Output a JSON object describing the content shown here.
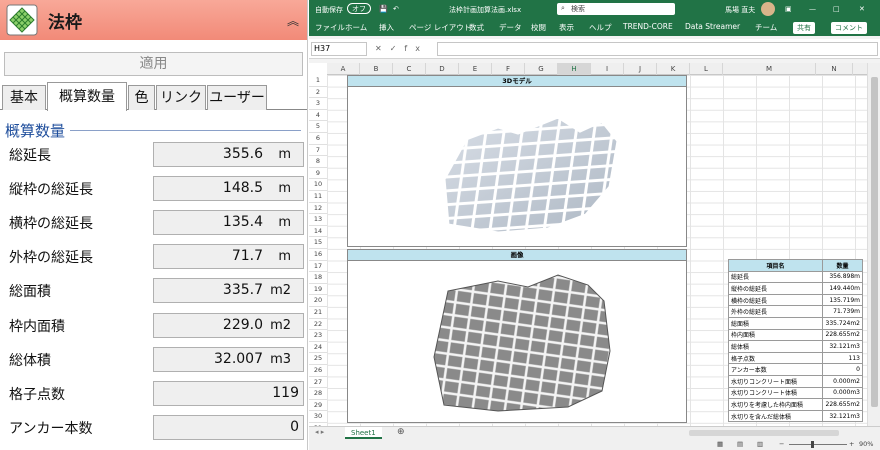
{
  "panel": {
    "title": "法枠",
    "apply_label": "適用",
    "tabs": [
      "基本",
      "概算数量",
      "色",
      "リンク",
      "ユーザー"
    ],
    "section": "概算数量",
    "rows": [
      {
        "label": "総延長",
        "value": "355.6",
        "unit": "m"
      },
      {
        "label": "縦枠の総延長",
        "value": "148.5",
        "unit": "m"
      },
      {
        "label": "横枠の総延長",
        "value": "135.4",
        "unit": "m"
      },
      {
        "label": "外枠の総延長",
        "value": "71.7",
        "unit": "m"
      },
      {
        "label": "総面積",
        "value": "335.7",
        "unit": "m2"
      },
      {
        "label": "枠内面積",
        "value": "229.0",
        "unit": "m2"
      },
      {
        "label": "総体積",
        "value": "32.007",
        "unit": "m3"
      },
      {
        "label": "格子点数",
        "value": "119",
        "unit": ""
      },
      {
        "label": "アンカー本数",
        "value": "0",
        "unit": ""
      }
    ]
  },
  "excel": {
    "autosave": "自動保存",
    "autosave_state": "オフ",
    "filename": "法枠計画加算法画.xlsx",
    "search": "検索",
    "user": "馬場 直夫",
    "menu": [
      "ファイル",
      "ホーム",
      "挿入",
      "ページ レイアウト",
      "数式",
      "データ",
      "校閲",
      "表示",
      "ヘルプ",
      "TREND-CORE",
      "Data Streamer",
      "チーム"
    ],
    "share": "共有",
    "comment": "コメント",
    "namebox": "H37",
    "fx": "fx",
    "columns": [
      "A",
      "B",
      "C",
      "D",
      "E",
      "F",
      "G",
      "H",
      "I",
      "J",
      "K",
      "L",
      "M",
      "N"
    ],
    "rows": [
      "1",
      "2",
      "3",
      "4",
      "5",
      "6",
      "7",
      "8",
      "9",
      "10",
      "11",
      "12",
      "13",
      "14",
      "15",
      "16",
      "17",
      "18",
      "19",
      "20",
      "21",
      "22",
      "23",
      "24",
      "25",
      "26",
      "27",
      "28",
      "29",
      "30",
      "31"
    ],
    "frame1_title": "3Dモデル",
    "frame2_title": "画像",
    "table_headers": [
      "項目名",
      "数量"
    ],
    "table_rows": [
      [
        "総延長",
        "356.898m"
      ],
      [
        "縦枠の総延長",
        "149.440m"
      ],
      [
        "横枠の総延長",
        "135.719m"
      ],
      [
        "外枠の総延長",
        "71.739m"
      ],
      [
        "総面積",
        "335.724m2"
      ],
      [
        "枠内面積",
        "228.655m2"
      ],
      [
        "総体積",
        "32.121m3"
      ],
      [
        "格子点数",
        "113"
      ],
      [
        "アンカー本数",
        "0"
      ],
      [
        "水切りコンクリート面積",
        "0.000m2"
      ],
      [
        "水切りコンクリート体積",
        "0.000m3"
      ],
      [
        "水切りを考慮した枠内面積",
        "228.655m2"
      ],
      [
        "水切りを含んだ総体積",
        "32.121m3"
      ]
    ],
    "sheet": "Sheet1",
    "zoom": "90%"
  },
  "colors": {
    "excel_green": "#217346",
    "header_pink": "#f28a78",
    "section_blue": "#1f4e9c",
    "table_header": "#bfe3ee"
  }
}
